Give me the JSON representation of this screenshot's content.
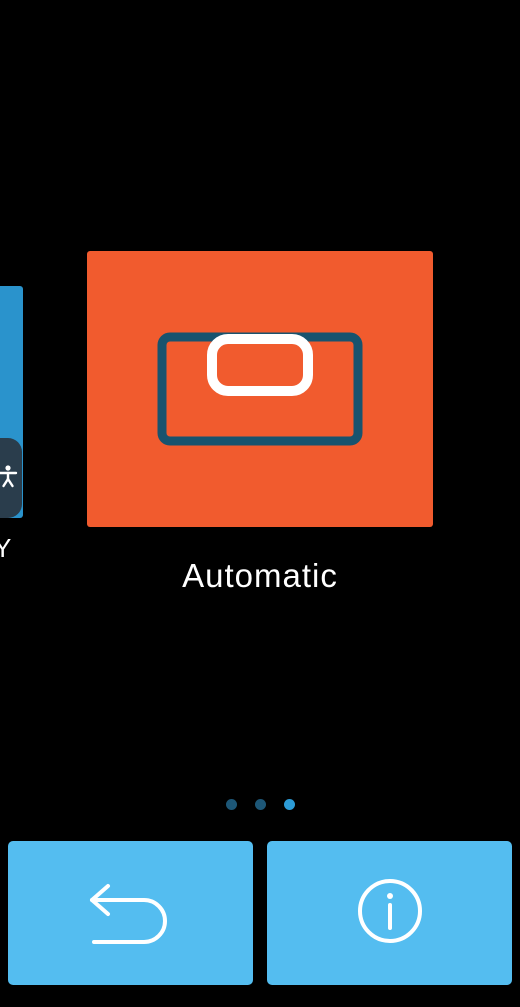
{
  "carousel": {
    "previous_item": {
      "label_fragment": "Y",
      "color": "#2a93cc"
    },
    "current_item": {
      "label": "Automatic",
      "color": "#f15b2e",
      "icon": "automatic-mode-icon"
    },
    "pager": {
      "count": 3,
      "active_index": 2,
      "active_color": "#2c9bd6",
      "inactive_color": "#1d5777"
    }
  },
  "accessibility_tab": {
    "icon": "accessibility-icon"
  },
  "bottom_bar": {
    "back_button": {
      "icon": "back-arrow-icon"
    },
    "info_button": {
      "icon": "info-icon"
    },
    "button_color": "#54bdf0"
  }
}
